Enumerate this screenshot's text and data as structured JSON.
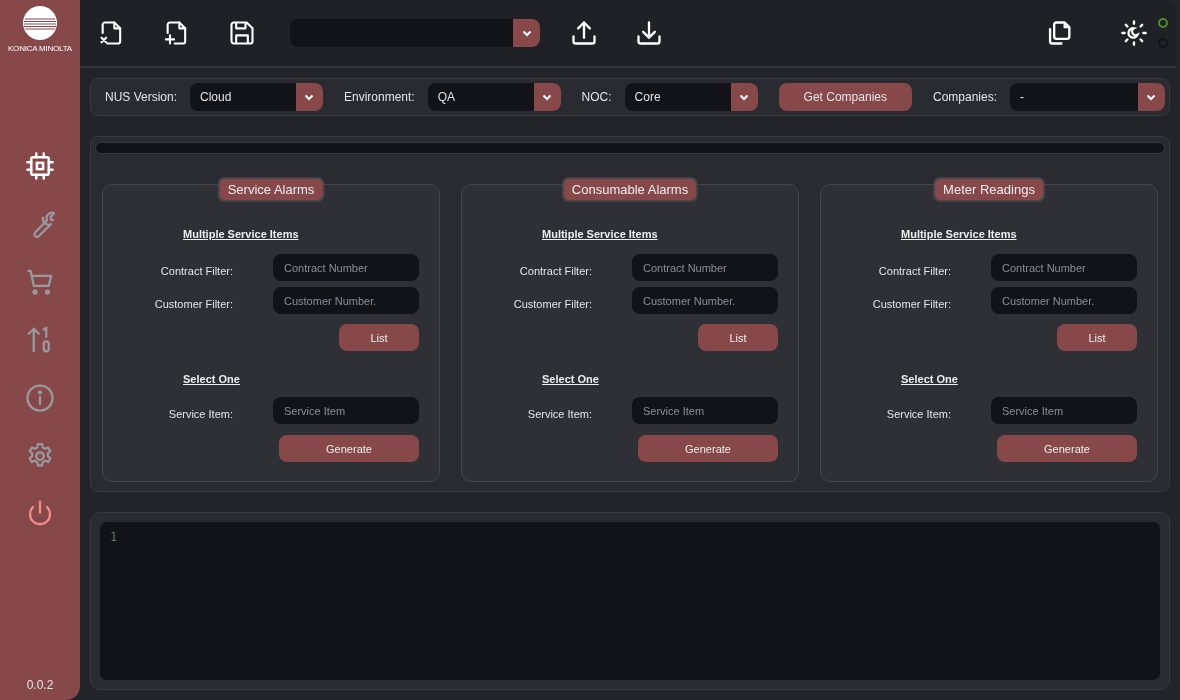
{
  "sidebar": {
    "logo_text": "KONICA MINOLTA",
    "items": [
      {
        "kind": "chip",
        "selected": true
      },
      {
        "kind": "wrench",
        "selected": false
      },
      {
        "kind": "cart",
        "selected": false
      },
      {
        "kind": "sort",
        "selected": false
      },
      {
        "kind": "info",
        "selected": false
      },
      {
        "kind": "gear",
        "selected": false
      },
      {
        "kind": "power",
        "selected": false
      }
    ],
    "version": "0.0.2"
  },
  "toolbar": {
    "status_lights": [
      {
        "color": "#4e8a2c"
      },
      {
        "color": "#141519"
      }
    ]
  },
  "filters": [
    {
      "kind": "select",
      "label": "NUS Version:",
      "value": "Cloud"
    },
    {
      "kind": "select",
      "label": "Environment:",
      "value": "QA"
    },
    {
      "kind": "select",
      "label": "NOC:",
      "value": "Core"
    },
    {
      "kind": "button",
      "label": "Get Companies"
    },
    {
      "kind": "select",
      "label": "Companies:",
      "value": "-"
    }
  ],
  "progress": {
    "level": 0
  },
  "cards": [
    {
      "title": "Service Alarms",
      "multi_heading": "Multiple Service Items",
      "contract_label": "Contract Filter:",
      "contract_placeholder": "Contract Number",
      "customer_label": "Customer Filter:",
      "customer_placeholder": "Customer Number.",
      "list_button": "List",
      "single_heading": "Select One",
      "item_label": "Service Item:",
      "item_placeholder": "Service Item",
      "generate_button": "Generate"
    },
    {
      "title": "Consumable Alarms",
      "multi_heading": "Multiple Service Items",
      "contract_label": "Contract Filter:",
      "contract_placeholder": "Contract Number",
      "customer_label": "Customer Filter:",
      "customer_placeholder": "Customer Number.",
      "list_button": "List",
      "single_heading": "Select One",
      "item_label": "Service Item:",
      "item_placeholder": "Service Item",
      "generate_button": "Generate"
    },
    {
      "title": "Meter Readings",
      "multi_heading": "Multiple Service Items",
      "contract_label": "Contract Filter:",
      "contract_placeholder": "Contract Number",
      "customer_label": "Customer Filter:",
      "customer_placeholder": "Customer Number.",
      "list_button": "List",
      "single_heading": "Select One",
      "item_label": "Service Item:",
      "item_placeholder": "Service Item",
      "generate_button": "Generate"
    }
  ],
  "editor": {
    "line_numbers": [
      "1"
    ]
  }
}
